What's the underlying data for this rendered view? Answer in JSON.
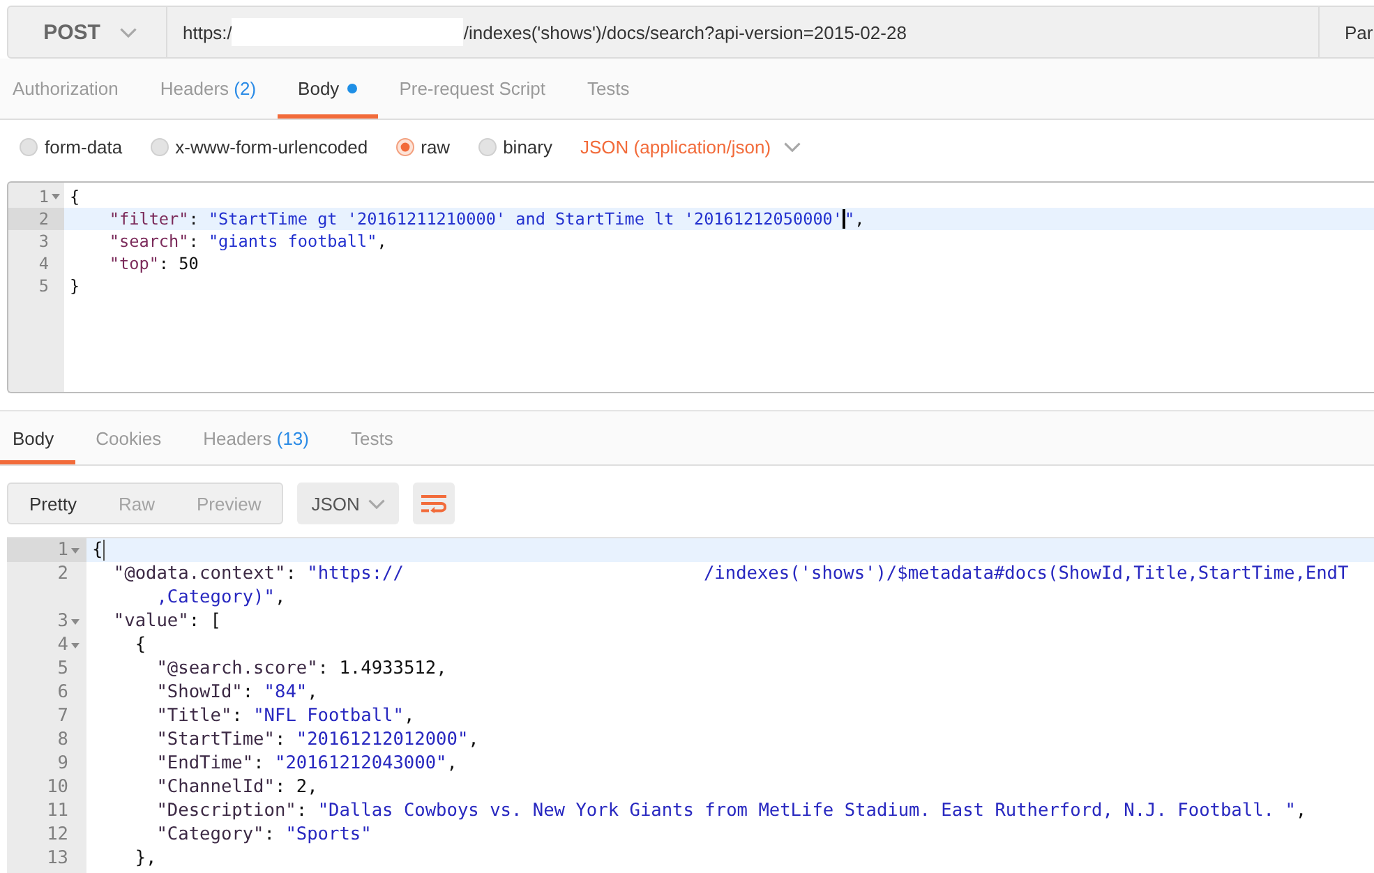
{
  "request_bar": {
    "method": "POST",
    "url": {
      "prefix": "https:/",
      "suffix": "/indexes('shows')/docs/search?api-version=2015-02-28"
    },
    "params_button": "Par"
  },
  "request_tabs": [
    {
      "label": "Authorization",
      "selected": false,
      "has_content": false
    },
    {
      "label": "Headers",
      "count": "(2)",
      "selected": false,
      "has_content": false
    },
    {
      "label": "Body",
      "selected": true,
      "has_content": true
    },
    {
      "label": "Pre-request Script",
      "selected": false,
      "has_content": false
    },
    {
      "label": "Tests",
      "selected": false,
      "has_content": false
    }
  ],
  "body_modes": [
    {
      "label": "form-data",
      "selected": false
    },
    {
      "label": "x-www-form-urlencoded",
      "selected": false
    },
    {
      "label": "raw",
      "selected": true
    },
    {
      "label": "binary",
      "selected": false
    }
  ],
  "content_type": "JSON (application/json)",
  "request_body": {
    "lines": [
      {
        "number": "1",
        "active": false,
        "segments": [
          {
            "kind": "punct",
            "text": "{"
          }
        ],
        "children": [
          {
            "number": "2",
            "active": true,
            "segments": [
              {
                "kind": "key",
                "text": "\"filter\""
              },
              {
                "kind": "punct",
                "text": ": "
              },
              {
                "kind": "string",
                "text": "\"StartTime gt '20161211210000' and StartTime lt '20161212050000'"
              },
              {
                "kind": "cursor"
              },
              {
                "kind": "string",
                "text": "\""
              },
              {
                "kind": "punct",
                "text": ","
              }
            ]
          },
          {
            "number": "3",
            "active": false,
            "segments": [
              {
                "kind": "key",
                "text": "\"search\""
              },
              {
                "kind": "punct",
                "text": ": "
              },
              {
                "kind": "string",
                "text": "\"giants football\""
              },
              {
                "kind": "punct",
                "text": ","
              }
            ]
          },
          {
            "number": "4",
            "active": false,
            "segments": [
              {
                "kind": "key",
                "text": "\"top\""
              },
              {
                "kind": "punct",
                "text": ": "
              },
              {
                "kind": "number",
                "text": "50"
              }
            ]
          }
        ]
      },
      {
        "number": "5",
        "active": false,
        "segments": [
          {
            "kind": "punct",
            "text": "}"
          }
        ]
      }
    ]
  },
  "response_tabs": [
    {
      "label": "Body",
      "selected": true
    },
    {
      "label": "Cookies",
      "selected": false
    },
    {
      "label": "Headers",
      "count": "(13)",
      "selected": false
    },
    {
      "label": "Tests",
      "selected": false
    }
  ],
  "view_modes": [
    {
      "label": "Pretty",
      "selected": true
    },
    {
      "label": "Raw",
      "selected": false
    },
    {
      "label": "Preview",
      "selected": false
    }
  ],
  "response_format": "JSON",
  "line_wrap": true,
  "response_body": {
    "lines": [
      {
        "number": "1",
        "active": true,
        "segments": [
          {
            "kind": "punct",
            "text": "{"
          },
          {
            "kind": "cursor"
          }
        ],
        "children": [
          {
            "number": "2",
            "active": false,
            "segments": [
              {
                "kind": "key",
                "text": "\"@odata.context\""
              },
              {
                "kind": "punct",
                "text": ": "
              },
              {
                "kind": "string",
                "text": "\"https://"
              },
              {
                "kind": "redaction"
              },
              {
                "kind": "string",
                "text": "/indexes('shows')/$metadata#docs(ShowId,Title,StartTime,EndT"
              }
            ],
            "continuation": [
              {
                "kind": "string",
                "text": ",Category)\""
              },
              {
                "kind": "punct",
                "text": ","
              }
            ]
          },
          {
            "number": "3",
            "active": false,
            "segments": [
              {
                "kind": "key",
                "text": "\"value\""
              },
              {
                "kind": "punct",
                "text": ": "
              },
              {
                "kind": "punct",
                "text": "["
              }
            ],
            "children": [
              {
                "number": "4",
                "active": false,
                "segments": [
                  {
                    "kind": "punct",
                    "text": "{"
                  }
                ],
                "children": [
                  {
                    "number": "5",
                    "active": false,
                    "segments": [
                      {
                        "kind": "key",
                        "text": "\"@search.score\""
                      },
                      {
                        "kind": "punct",
                        "text": ": "
                      },
                      {
                        "kind": "number",
                        "text": "1.4933512"
                      },
                      {
                        "kind": "punct",
                        "text": ","
                      }
                    ]
                  },
                  {
                    "number": "6",
                    "active": false,
                    "segments": [
                      {
                        "kind": "key",
                        "text": "\"ShowId\""
                      },
                      {
                        "kind": "punct",
                        "text": ": "
                      },
                      {
                        "kind": "string",
                        "text": "\"84\""
                      },
                      {
                        "kind": "punct",
                        "text": ","
                      }
                    ]
                  },
                  {
                    "number": "7",
                    "active": false,
                    "segments": [
                      {
                        "kind": "key",
                        "text": "\"Title\""
                      },
                      {
                        "kind": "punct",
                        "text": ": "
                      },
                      {
                        "kind": "string",
                        "text": "\"NFL Football\""
                      },
                      {
                        "kind": "punct",
                        "text": ","
                      }
                    ]
                  },
                  {
                    "number": "8",
                    "active": false,
                    "segments": [
                      {
                        "kind": "key",
                        "text": "\"StartTime\""
                      },
                      {
                        "kind": "punct",
                        "text": ": "
                      },
                      {
                        "kind": "string",
                        "text": "\"20161212012000\""
                      },
                      {
                        "kind": "punct",
                        "text": ","
                      }
                    ]
                  },
                  {
                    "number": "9",
                    "active": false,
                    "segments": [
                      {
                        "kind": "key",
                        "text": "\"EndTime\""
                      },
                      {
                        "kind": "punct",
                        "text": ": "
                      },
                      {
                        "kind": "string",
                        "text": "\"20161212043000\""
                      },
                      {
                        "kind": "punct",
                        "text": ","
                      }
                    ]
                  },
                  {
                    "number": "10",
                    "active": false,
                    "segments": [
                      {
                        "kind": "key",
                        "text": "\"ChannelId\""
                      },
                      {
                        "kind": "punct",
                        "text": ": "
                      },
                      {
                        "kind": "number",
                        "text": "2"
                      },
                      {
                        "kind": "punct",
                        "text": ","
                      }
                    ]
                  },
                  {
                    "number": "11",
                    "active": false,
                    "segments": [
                      {
                        "kind": "key",
                        "text": "\"Description\""
                      },
                      {
                        "kind": "punct",
                        "text": ": "
                      },
                      {
                        "kind": "string",
                        "text": "\"Dallas Cowboys vs. New York Giants from MetLife Stadium. East Rutherford, N.J. Football. \""
                      },
                      {
                        "kind": "punct",
                        "text": ","
                      }
                    ]
                  },
                  {
                    "number": "12",
                    "active": false,
                    "segments": [
                      {
                        "kind": "key",
                        "text": "\"Category\""
                      },
                      {
                        "kind": "punct",
                        "text": ": "
                      },
                      {
                        "kind": "string",
                        "text": "\"Sports\""
                      }
                    ]
                  }
                ]
              },
              {
                "number": "13",
                "active": false,
                "segments": [
                  {
                    "kind": "punct",
                    "text": "},"
                  }
                ]
              }
            ]
          }
        ]
      }
    ]
  }
}
